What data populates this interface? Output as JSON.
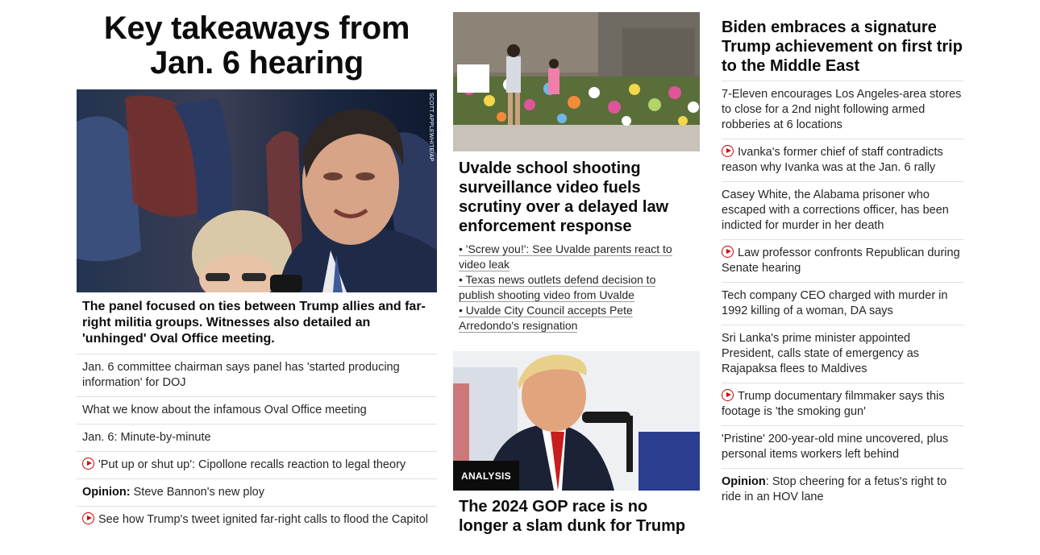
{
  "left": {
    "headline": "Key takeaways from Jan. 6 hearing",
    "image_credit": "SCOTT APPLEWHITE/AP",
    "lead_description": "The panel focused on ties between Trump allies and far-right militia groups. Witnesses also detailed an 'unhinged' Oval Office meeting.",
    "links": [
      {
        "text": "Jan. 6 committee chairman says panel has 'started producing information' for DOJ"
      },
      {
        "text": "What we know about the infamous Oval Office meeting"
      },
      {
        "text": "Jan. 6: Minute-by-minute"
      },
      {
        "text": "'Put up or shut up': Cipollone recalls reaction to legal theory",
        "video": true
      },
      {
        "label": "Opinion:",
        "text": " Steve Bannon's new ploy"
      },
      {
        "text": "See how Trump's tweet ignited far-right calls to flood the Capitol",
        "video": true
      }
    ]
  },
  "middle": {
    "uvalde_headline": "Uvalde school shooting surveillance video fuels scrutiny over a delayed law enforcement response",
    "bullets": [
      "• 'Screw you!': See Uvalde parents react to video leak",
      "• Texas news outlets defend decision to publish shooting video from Uvalde",
      "• Uvalde City Council accepts Pete Arredondo's resignation"
    ],
    "analysis_badge": "ANALYSIS",
    "gop_headline": "The 2024 GOP race is no longer a slam dunk for Trump"
  },
  "right": {
    "headline": "Biden embraces a signature Trump achievement on first trip to the Middle East",
    "links": [
      {
        "text": "7-Eleven encourages Los Angeles-area stores to close for a 2nd night following armed robberies at 6 locations"
      },
      {
        "text": "Ivanka's former chief of staff contradicts reason why Ivanka was at the Jan. 6 rally",
        "video": true
      },
      {
        "text": "Casey White, the Alabama prisoner who escaped with a corrections officer, has been indicted for murder in her death"
      },
      {
        "text": "Law professor confronts Republican during Senate hearing",
        "video": true
      },
      {
        "text": "Tech company CEO charged with murder in 1992 killing of a woman, DA says"
      },
      {
        "text": "Sri Lanka's prime minister appointed President, calls state of emergency as Rajapaksa flees to Maldives"
      },
      {
        "text": "Trump documentary filmmaker says this footage is 'the smoking gun'",
        "video": true
      },
      {
        "text": "'Pristine' 200-year-old mine uncovered, plus personal items workers left behind"
      },
      {
        "label": "Opinion",
        "text": ": Stop cheering for a fetus's right to ride in an HOV lane"
      }
    ]
  }
}
